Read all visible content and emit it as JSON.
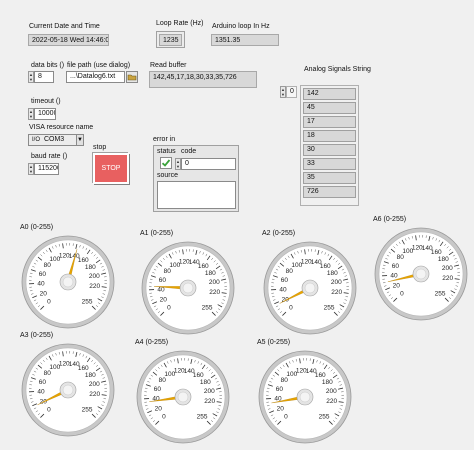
{
  "labels": {
    "current_date": "Current Date and Time",
    "loop_rate": "Loop Rate (Hz)",
    "arduino_loop": "Arduino loop In Hz",
    "data_bits": "data bits ()",
    "file_path": "file path (use dialog)",
    "read_buffer": "Read buffer",
    "analog_string": "Analog Signals String",
    "timeout": "timeout ()",
    "visa": "VISA resource name",
    "baud": "baud rate ()",
    "stop": "stop",
    "error_in": "error in",
    "status": "status",
    "code": "code",
    "source": "source"
  },
  "values": {
    "current_date": "2022-05-18 Wed 14:46:04.692",
    "loop_rate": "1235",
    "arduino_loop": "1351.35",
    "data_bits": "8",
    "file_path": "...\\Datalog6.txt",
    "read_buffer": "142,45,17,18,30,33,35,726",
    "timeout": "10000",
    "visa": "COM3",
    "baud": "115200",
    "stop_button": "STOP",
    "array_index": "0",
    "error_code": "0",
    "error_source": ""
  },
  "analog_array": [
    "142",
    "45",
    "17",
    "18",
    "30",
    "33",
    "35",
    "726"
  ],
  "gauge_ticks": [
    "0",
    "20",
    "40",
    "60",
    "80",
    "100",
    "120",
    "140",
    "160",
    "180",
    "200",
    "220",
    "255"
  ],
  "gauges": [
    {
      "name": "A0 (0-255)",
      "value": 142
    },
    {
      "name": "A1 (0-255)",
      "value": 45
    },
    {
      "name": "A2 (0-255)",
      "value": 17
    },
    {
      "name": "A6 (0-255)",
      "value": 30
    },
    {
      "name": "A3 (0-255)",
      "value": 18
    },
    {
      "name": "A4 (0-255)",
      "value": 35
    },
    {
      "name": "A5 (0-255)",
      "value": 33
    }
  ],
  "colors": {
    "needle": "#e8a400",
    "stop_button": "#e86060",
    "status_ok": "#3aa33a"
  }
}
